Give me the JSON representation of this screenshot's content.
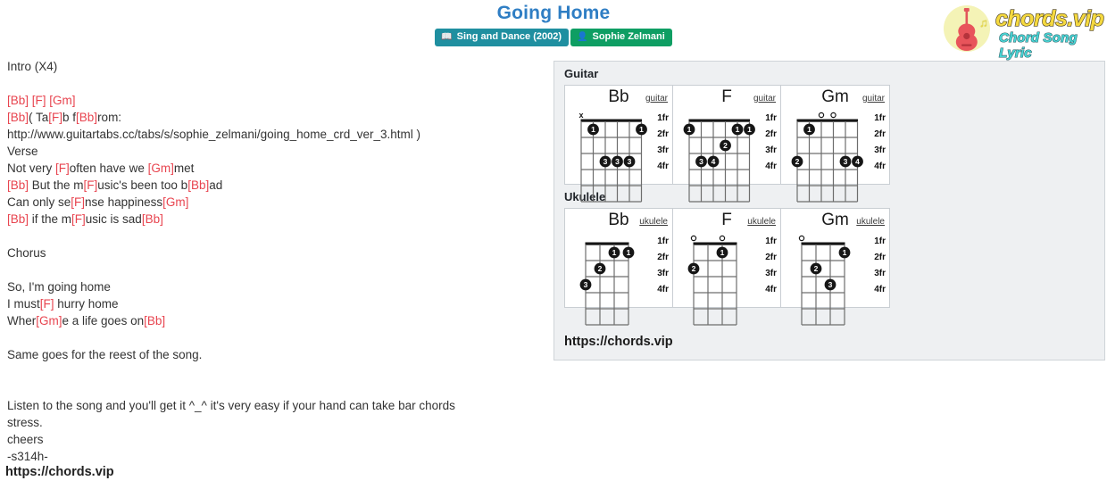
{
  "header": {
    "title": "Going Home",
    "badges": [
      {
        "icon": "album-icon",
        "label": "Sing and Dance (2002)",
        "color": "#1f8fa0"
      },
      {
        "icon": "user-icon",
        "label": "Sophie Zelmani",
        "color": "#0e9e63"
      }
    ]
  },
  "logo": {
    "main": "chords.vip",
    "sub": "Chord Song Lyric",
    "icon": "guitar-icon",
    "note_icon": "music-note-icon",
    "main_color": "#f5d93f",
    "sub_color": "#49d6d6",
    "circle_color": "#f4f3b6"
  },
  "lyrics": {
    "chord_color": "#e8444f",
    "lines": [
      [
        {
          "t": "Intro (X4)",
          "c": false
        }
      ],
      [],
      [
        {
          "t": "[Bb]",
          "c": true
        },
        {
          "t": " ",
          "c": false
        },
        {
          "t": "[F]",
          "c": true
        },
        {
          "t": " ",
          "c": false
        },
        {
          "t": "[Gm]",
          "c": true
        }
      ],
      [
        {
          "t": "[Bb]",
          "c": true
        },
        {
          "t": "( Ta",
          "c": false
        },
        {
          "t": "[F]",
          "c": true
        },
        {
          "t": "b f",
          "c": false
        },
        {
          "t": "[Bb]",
          "c": true
        },
        {
          "t": "rom:",
          "c": false
        }
      ],
      [
        {
          "t": "http://www.guitartabs.cc/tabs/s/sophie_zelmani/going_home_crd_ver_3.html )",
          "c": false
        }
      ],
      [
        {
          "t": "Verse",
          "c": false
        }
      ],
      [
        {
          "t": "Not very ",
          "c": false
        },
        {
          "t": "[F]",
          "c": true
        },
        {
          "t": "often have we ",
          "c": false
        },
        {
          "t": "[Gm]",
          "c": true
        },
        {
          "t": "met",
          "c": false
        }
      ],
      [
        {
          "t": "[Bb]",
          "c": true
        },
        {
          "t": " But the m",
          "c": false
        },
        {
          "t": "[F]",
          "c": true
        },
        {
          "t": "usic's been too b",
          "c": false
        },
        {
          "t": "[Bb]",
          "c": true
        },
        {
          "t": "ad",
          "c": false
        }
      ],
      [
        {
          "t": "Can only se",
          "c": false
        },
        {
          "t": "[F]",
          "c": true
        },
        {
          "t": "nse happiness",
          "c": false
        },
        {
          "t": "[Gm]",
          "c": true
        }
      ],
      [
        {
          "t": "[Bb]",
          "c": true
        },
        {
          "t": " if the m",
          "c": false
        },
        {
          "t": "[F]",
          "c": true
        },
        {
          "t": "usic is sad",
          "c": false
        },
        {
          "t": "[Bb]",
          "c": true
        }
      ],
      [],
      [
        {
          "t": "Chorus",
          "c": false
        }
      ],
      [],
      [
        {
          "t": "So, I'm going home",
          "c": false
        }
      ],
      [
        {
          "t": "I must",
          "c": false
        },
        {
          "t": "[F]",
          "c": true
        },
        {
          "t": " hurry home",
          "c": false
        }
      ],
      [
        {
          "t": "Wher",
          "c": false
        },
        {
          "t": "[Gm]",
          "c": true
        },
        {
          "t": "e a life goes on",
          "c": false
        },
        {
          "t": "[Bb]",
          "c": true
        }
      ],
      [],
      [
        {
          "t": "Same goes for the reest of the song.",
          "c": false
        }
      ],
      [],
      [],
      [
        {
          "t": "Listen to the song and you'll get it ^_^ it's very easy if your hand can take bar chords",
          "c": false
        }
      ],
      [
        {
          "t": "stress.",
          "c": false
        }
      ],
      [
        {
          "t": "cheers",
          "c": false
        }
      ],
      [
        {
          "t": "-s314h-",
          "c": false
        }
      ]
    ],
    "bottom_url": "https://chords.vip"
  },
  "chord_panel": {
    "guitar_heading": "Guitar",
    "ukulele_heading": "Ukulele",
    "panel_url": "https://chords.vip",
    "fret_labels": [
      "1fr",
      "2fr",
      "3fr",
      "4fr"
    ],
    "guitar": [
      {
        "name": "Bb",
        "instrument": "guitar",
        "strings": 6,
        "frets": 4,
        "open": [],
        "muted": [
          1
        ],
        "dots": [
          {
            "string": 2,
            "fret": 1,
            "finger": "1"
          },
          {
            "string": 6,
            "fret": 1,
            "finger": "1"
          },
          {
            "string": 3,
            "fret": 3,
            "finger": "3"
          },
          {
            "string": 4,
            "fret": 3,
            "finger": "3"
          },
          {
            "string": 5,
            "fret": 3,
            "finger": "3"
          }
        ]
      },
      {
        "name": "F",
        "instrument": "guitar",
        "strings": 6,
        "frets": 4,
        "open": [],
        "muted": [],
        "dots": [
          {
            "string": 1,
            "fret": 1,
            "finger": "1"
          },
          {
            "string": 5,
            "fret": 1,
            "finger": "1"
          },
          {
            "string": 6,
            "fret": 1,
            "finger": "1"
          },
          {
            "string": 4,
            "fret": 2,
            "finger": "2"
          },
          {
            "string": 2,
            "fret": 3,
            "finger": "3"
          },
          {
            "string": 3,
            "fret": 3,
            "finger": "4"
          }
        ]
      },
      {
        "name": "Gm",
        "instrument": "guitar",
        "strings": 6,
        "frets": 4,
        "open": [
          3,
          4
        ],
        "muted": [],
        "dots": [
          {
            "string": 2,
            "fret": 1,
            "finger": "1"
          },
          {
            "string": 1,
            "fret": 3,
            "finger": "2"
          },
          {
            "string": 5,
            "fret": 3,
            "finger": "3"
          },
          {
            "string": 6,
            "fret": 3,
            "finger": "4"
          }
        ]
      }
    ],
    "ukulele": [
      {
        "name": "Bb",
        "instrument": "ukulele",
        "strings": 4,
        "frets": 4,
        "open": [],
        "muted": [],
        "dots": [
          {
            "string": 3,
            "fret": 1,
            "finger": "1"
          },
          {
            "string": 4,
            "fret": 1,
            "finger": "1"
          },
          {
            "string": 2,
            "fret": 2,
            "finger": "2"
          },
          {
            "string": 1,
            "fret": 3,
            "finger": "3"
          }
        ]
      },
      {
        "name": "F",
        "instrument": "ukulele",
        "strings": 4,
        "frets": 4,
        "open": [
          1,
          3
        ],
        "muted": [],
        "dots": [
          {
            "string": 3,
            "fret": 1,
            "finger": "1"
          },
          {
            "string": 1,
            "fret": 2,
            "finger": "2"
          }
        ]
      },
      {
        "name": "Gm",
        "instrument": "ukulele",
        "strings": 4,
        "frets": 4,
        "open": [
          1
        ],
        "muted": [],
        "dots": [
          {
            "string": 4,
            "fret": 1,
            "finger": "1"
          },
          {
            "string": 2,
            "fret": 2,
            "finger": "2"
          },
          {
            "string": 3,
            "fret": 3,
            "finger": "3"
          }
        ]
      }
    ]
  }
}
